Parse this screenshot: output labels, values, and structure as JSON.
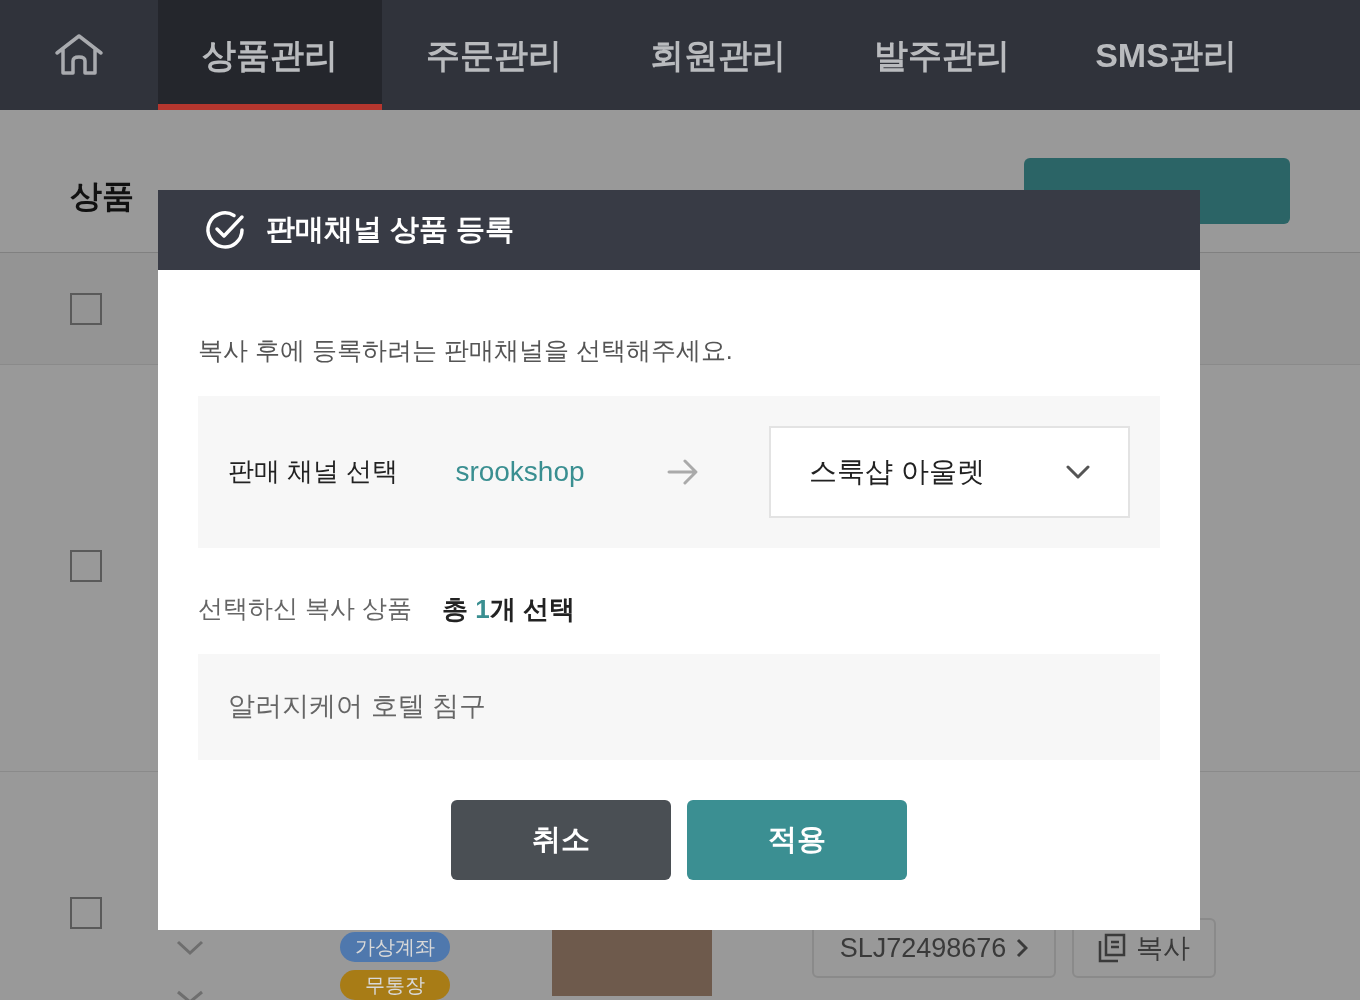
{
  "nav": {
    "tabs": [
      {
        "label": "상품관리",
        "selected": true
      },
      {
        "label": "주문관리",
        "selected": false
      },
      {
        "label": "회원관리",
        "selected": false
      },
      {
        "label": "발주관리",
        "selected": false
      },
      {
        "label": "SMS관리",
        "selected": false
      }
    ]
  },
  "page": {
    "title": "상품",
    "rows": [
      {
        "checked": false
      },
      {
        "checked": false
      },
      {
        "checked": false,
        "badges": [
          {
            "label": "가상계좌",
            "color": "#4f78ad"
          },
          {
            "label": "무통장",
            "color": "#a87c16"
          }
        ],
        "code": "SLJ72498676",
        "copy": "복사"
      }
    ]
  },
  "modal": {
    "title": "판매채널 상품 등록",
    "instruction": "복사 후에 등록하려는 판매채널을 선택해주세요.",
    "channel": {
      "label": "판매 채널 선택",
      "source": "srookshop",
      "target": "스룩샵 아울렛"
    },
    "selection": {
      "label": "선택하신 복사 상품",
      "prefix": "총 ",
      "count": "1",
      "suffix": "개 선택"
    },
    "items": [
      "알러지케어 호텔 침구"
    ],
    "buttons": [
      {
        "kind": "cancel",
        "label": "취소"
      },
      {
        "kind": "apply",
        "label": "적용"
      }
    ]
  }
}
